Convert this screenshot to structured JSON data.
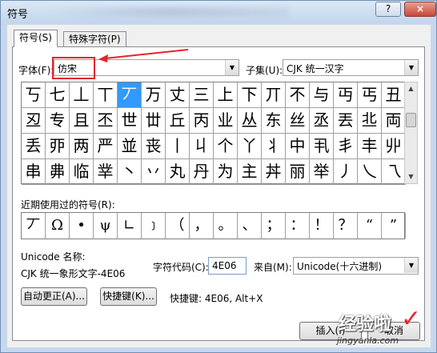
{
  "window": {
    "title": "符号",
    "help_label": "?",
    "close_label": "×"
  },
  "tabs": [
    {
      "label": "符号(S)",
      "active": true
    },
    {
      "label": "特殊字符(P)",
      "active": false
    }
  ],
  "font": {
    "label": "字体(F):",
    "value": "仿宋"
  },
  "subset": {
    "label": "子集(U):",
    "value": "CJK 统一汉字"
  },
  "symbol_grid": {
    "rows": [
      [
        "丂",
        "七",
        "丄",
        "丅",
        "丆",
        "万",
        "丈",
        "三",
        "上",
        "下",
        "丌",
        "不",
        "与",
        "丏",
        "丐",
        "丑"
      ],
      [
        "丒",
        "专",
        "且",
        "丕",
        "世",
        "丗",
        "丘",
        "丙",
        "业",
        "丛",
        "东",
        "丝",
        "丞",
        "丟",
        "丠",
        "両"
      ],
      [
        "丢",
        "丣",
        "两",
        "严",
        "並",
        "丧",
        "丨",
        "丩",
        "个",
        "丫",
        "丬",
        "中",
        "丮",
        "丯",
        "丰",
        "丱"
      ],
      [
        "串",
        "丳",
        "临",
        "丵",
        "丶",
        "丷",
        "丸",
        "丹",
        "为",
        "主",
        "丼",
        "丽",
        "举",
        "丿",
        "乀",
        "乁"
      ]
    ],
    "selected": "丆"
  },
  "recent": {
    "label": "近期使用过的符号(R):",
    "symbols": [
      "丆",
      "Ω",
      "•",
      "ψ",
      "∟",
      "﹞",
      "（",
      "，",
      "。",
      "、",
      "；",
      "：",
      "！",
      "？",
      "“",
      "”"
    ]
  },
  "unicode": {
    "name_label": "Unicode 名称:",
    "name_value": "CJK 统一象形文字-4E06"
  },
  "char_code": {
    "label": "字符代码(C):",
    "value": "4E06"
  },
  "from": {
    "label": "来自(M):",
    "value": "Unicode(十六进制)"
  },
  "buttons": {
    "autocorrect": "自动更正(A)...",
    "shortcut": "快捷键(K)...",
    "shortcut_text": "快捷键: 4E06, Alt+X",
    "insert": "插入(I)",
    "cancel": "取消"
  },
  "watermark": {
    "text": "经验啦",
    "url": "jingyanla.com",
    "check": "✓"
  },
  "colors": {
    "selection": "#3399ff",
    "annotation_red": "#e2262c"
  }
}
